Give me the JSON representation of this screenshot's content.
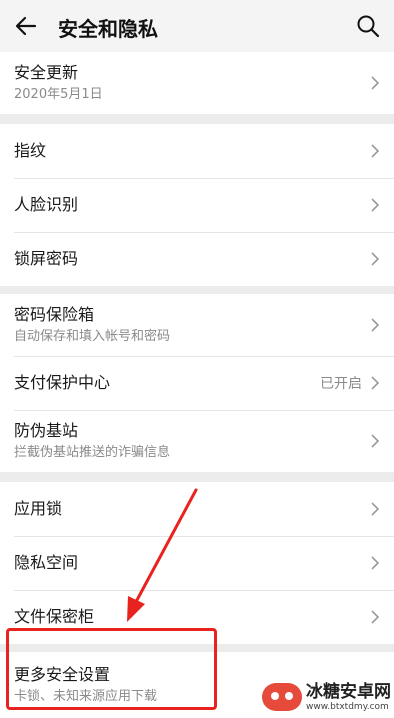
{
  "header": {
    "title": "安全和隐私",
    "back_icon": "back-arrow-icon",
    "search_icon": "search-icon"
  },
  "groups": [
    {
      "items": [
        {
          "label": "安全更新",
          "sub": "2020年5月1日"
        }
      ]
    },
    {
      "items": [
        {
          "label": "指纹"
        },
        {
          "label": "人脸识别"
        },
        {
          "label": "锁屏密码"
        }
      ]
    },
    {
      "items": [
        {
          "label": "密码保险箱",
          "sub": "自动保存和填入帐号和密码"
        },
        {
          "label": "支付保护中心",
          "status": "已开启"
        },
        {
          "label": "防伪基站",
          "sub": "拦截伪基站推送的诈骗信息"
        }
      ]
    },
    {
      "items": [
        {
          "label": "应用锁"
        },
        {
          "label": "隐私空间"
        },
        {
          "label": "文件保密柜"
        }
      ]
    },
    {
      "items": [
        {
          "label": "更多安全设置",
          "sub": "卡锁、未知来源应用下载"
        }
      ]
    }
  ],
  "annotation": {
    "color": "#e8231f"
  },
  "watermark": {
    "name": "冰糖安卓网",
    "url": "www.btxtdmy.com"
  },
  "colors": {
    "background": "#ececec",
    "card": "#ffffff",
    "secondary_text": "#8a8a8a"
  }
}
